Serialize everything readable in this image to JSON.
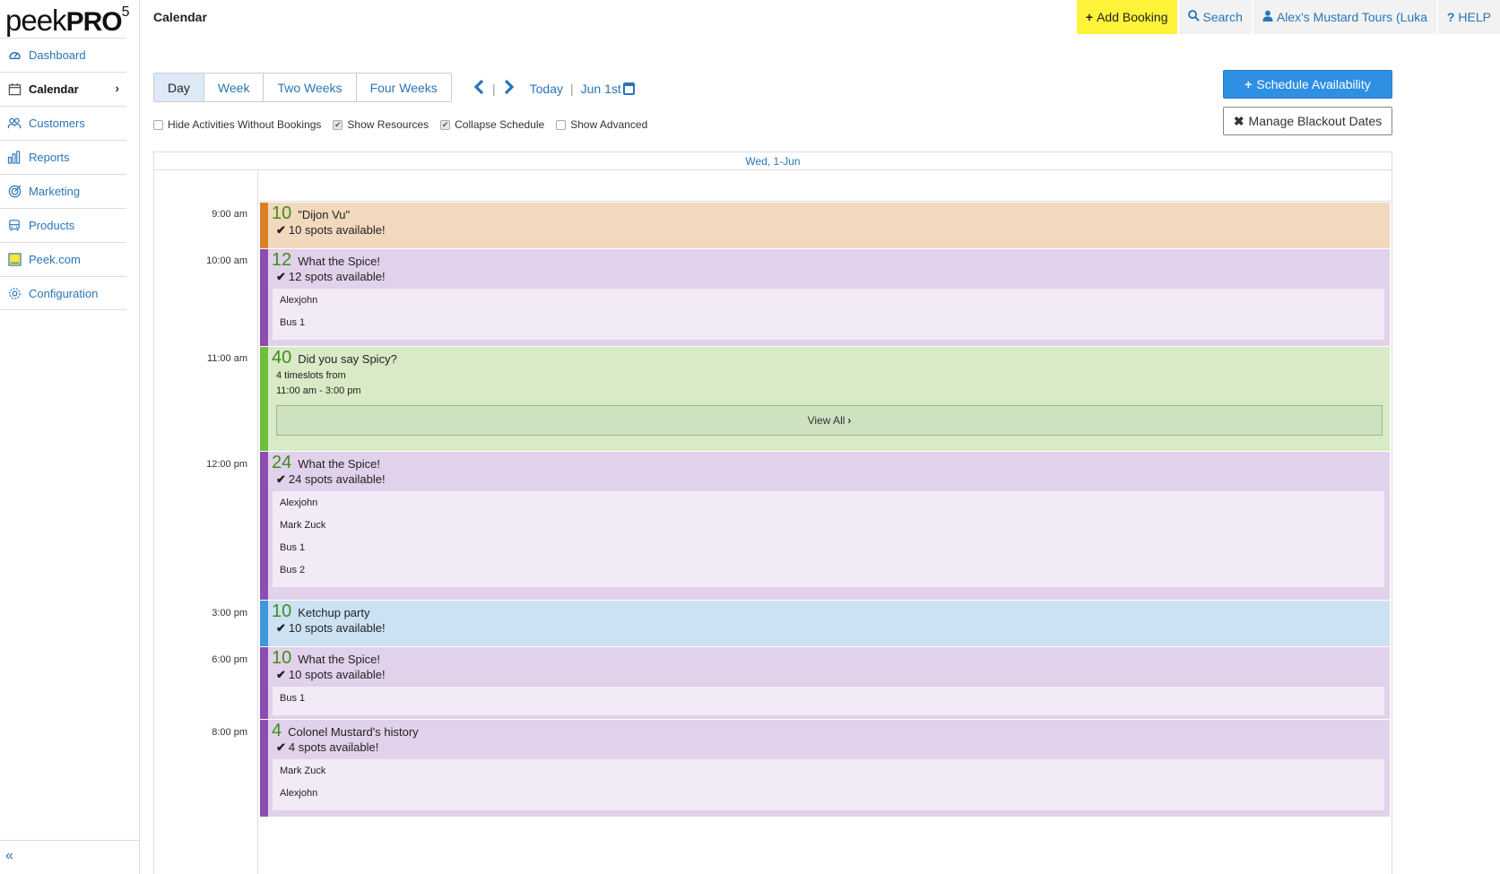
{
  "logo": {
    "peek": "peek",
    "pro": "PRO",
    "version": "5"
  },
  "sidebar": {
    "items": [
      {
        "label": "Dashboard",
        "icon": "dashboard-icon"
      },
      {
        "label": "Calendar",
        "icon": "calendar-icon"
      },
      {
        "label": "Customers",
        "icon": "customers-icon"
      },
      {
        "label": "Reports",
        "icon": "reports-icon"
      },
      {
        "label": "Marketing",
        "icon": "marketing-icon"
      },
      {
        "label": "Products",
        "icon": "products-icon"
      },
      {
        "label": "Peek.com",
        "icon": "peek-com-icon"
      },
      {
        "label": "Configuration",
        "icon": "gear-icon"
      }
    ],
    "active": "Calendar",
    "collapse_label": "«"
  },
  "header": {
    "page_title": "Calendar",
    "add_booking": "Add Booking",
    "search": "Search",
    "account": "Alex's Mustard Tours (Luka",
    "help": "HELP"
  },
  "toolbar": {
    "view_tabs": [
      "Day",
      "Week",
      "Two Weeks",
      "Four Weeks"
    ],
    "active_view": "Day",
    "today": "Today",
    "date": "Jun 1st",
    "schedule_availability": "Schedule Availability",
    "manage_blackout": "Manage Blackout Dates"
  },
  "options": [
    {
      "label": "Hide Activities Without Bookings",
      "checked": false
    },
    {
      "label": "Show Resources",
      "checked": true
    },
    {
      "label": "Collapse Schedule",
      "checked": true
    },
    {
      "label": "Show Advanced",
      "checked": false
    }
  ],
  "calendar": {
    "day_header": "Wed, 1-Jun",
    "time_labels": [
      "9:00 am",
      "10:00 am",
      "11:00 am",
      "12:00 pm",
      "3:00 pm",
      "6:00 pm",
      "8:00 pm"
    ],
    "events": [
      {
        "count": "10",
        "title": "\"Dijon Vu\"",
        "availability": "10 spots available!",
        "color": "#f2d8bd",
        "accent": "#d98026",
        "resources": []
      },
      {
        "count": "12",
        "title": "What the Spice!",
        "availability": "12 spots available!",
        "color": "#e2d1ea",
        "accent": "#8e4bb0",
        "resources": [
          "Alexjohn",
          "Bus 1"
        ]
      },
      {
        "count": "40",
        "title": "Did you say Spicy?",
        "timeslots_line1": "4 timeslots from",
        "timeslots_line2": "11:00 am - 3:00 pm",
        "view_all": "View All",
        "color": "#d8ebc6",
        "accent": "#6ebe3c"
      },
      {
        "count": "24",
        "title": "What the Spice!",
        "availability": "24 spots available!",
        "color": "#e2d1ea",
        "accent": "#8e4bb0",
        "resources": [
          "Alexjohn",
          "Mark Zuck",
          "Bus 1",
          "Bus 2"
        ]
      },
      {
        "count": "10",
        "title": "Ketchup party",
        "availability": "10 spots available!",
        "color": "#cce2f3",
        "accent": "#3e97d8",
        "resources": []
      },
      {
        "count": "10",
        "title": "What the Spice!",
        "availability": "10 spots available!",
        "color": "#e2d1ea",
        "accent": "#8e4bb0",
        "resources": [
          "Bus 1"
        ]
      },
      {
        "count": "4",
        "title": "Colonel Mustard's history",
        "availability": "4 spots available!",
        "color": "#e2d1ea",
        "accent": "#8e4bb0",
        "resources": [
          "Mark Zuck",
          "Alexjohn"
        ]
      }
    ]
  }
}
